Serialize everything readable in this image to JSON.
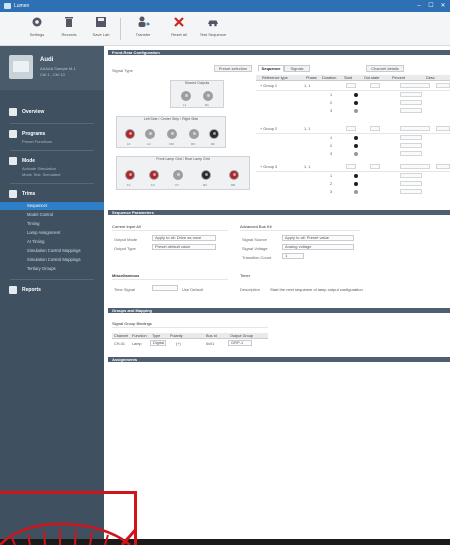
{
  "window": {
    "title": "Lumen",
    "controls": [
      "–",
      "☐",
      "✕"
    ]
  },
  "toolbar": {
    "buttons": [
      {
        "label": "Settings",
        "icon": "gear-icon"
      },
      {
        "label": "Records",
        "icon": "trash-icon"
      },
      {
        "label": "Save Lab",
        "icon": "save-icon"
      },
      {
        "label": "Transfer",
        "icon": "user-transfer-icon"
      },
      {
        "label": "Reset all",
        "icon": "close-icon"
      },
      {
        "label": "Test Sequence",
        "icon": "car-icon"
      }
    ]
  },
  "sidebar": {
    "profile": {
      "name": "Audi",
      "line1": "AAAAA Sample M-1",
      "line2": "Ctrl 1 - Ctrl 10"
    },
    "sections": [
      {
        "title": "Overview",
        "icon": "list-icon",
        "sub": ""
      },
      {
        "title": "Programs",
        "icon": "program-icon",
        "sub": "Preset Functions"
      },
      {
        "title": "Mode",
        "icon": "mode-icon",
        "sub": "Activate Simulation",
        "sub2": "Mode Test: Simulated"
      },
      {
        "title": "Trims",
        "icon": "trims-icon",
        "sub": ""
      }
    ],
    "nav": [
      "Sequencer",
      "Model Control",
      "Timing",
      "Lamp Assignment",
      "AI Timing",
      "Simulation Control Mappings",
      "Simulation Control Mappings",
      "Tertiary Groups"
    ],
    "active_index": 0,
    "footer_section": {
      "title": "Reports",
      "icon": "report-icon"
    }
  },
  "main": {
    "top_section": "Front-Rear Configuration",
    "config_label": "Signal Type",
    "preset_button": "Preset selection",
    "tabs": [
      "Sequence",
      "Signals"
    ],
    "tab_right": "Channel details",
    "top_panel_label": "Shared Outputs",
    "mid_panel_label": "Left Side / Center Strip / Right Side",
    "bottom_panel_label": "Front Lamp Grid / Rear Lamp Grid",
    "dot_labels_top": [
      "L1",
      "R1"
    ],
    "dot_labels_mid": [
      "LF",
      "LC",
      "CM",
      "RC",
      "RF"
    ],
    "dot_labels_bot": [
      "FL",
      "FC",
      "CT",
      "RC",
      "RR"
    ],
    "table_headers": [
      "Reference type",
      "Phase",
      "Duration",
      "Start",
      "Out state",
      "Percent",
      "Desc"
    ],
    "table_groups": [
      {
        "label": "+ Group 1",
        "count": "1, 1",
        "rows": [
          "1",
          "2",
          "3"
        ]
      },
      {
        "label": "+ Group 2",
        "count": "1, 1",
        "rows": [
          "1",
          "2",
          "3"
        ]
      },
      {
        "label": "+ Group 3",
        "count": "1, 1",
        "rows": [
          "1",
          "2",
          "3"
        ]
      }
    ],
    "mid_section": "Sequence Parameters",
    "left_group_title": "Current Input All",
    "left_fields": [
      [
        "Output Mode",
        "Apply to all: Drive as once"
      ],
      [
        "Output Type",
        "Preset default value"
      ]
    ],
    "right_group_title": "Advanced Bus Kit",
    "right_fields": [
      [
        "Signal Source",
        "Apply to all: Preset value"
      ],
      [
        "Signal Voltage",
        "Analog voltage"
      ],
      [
        "Transition Count",
        "1"
      ]
    ],
    "misc_section": "Miscellaneous",
    "misc_left_label": "Time Signal",
    "misc_left_value": "Use Default",
    "misc_right_label": "Timer",
    "misc_right_label2": "Description",
    "misc_right_value": "Start the next sequence of lamp output configuration",
    "group_section": "Groups and Mapping",
    "group_subtitle": "Signal Group Bindings",
    "group_headers": [
      "Channel",
      "Function",
      "Type",
      "Polarity",
      "",
      "Bus Id",
      "Output Group"
    ],
    "group_row": [
      "CH-01",
      "Lamp",
      "Digital",
      "(+)",
      "",
      "0x01",
      "GRP-1"
    ],
    "last_section": "Assignments"
  },
  "colors": {
    "accent": "#2f7fc8",
    "titlebar": "#2f6fb3",
    "sidebar": "#3f5061",
    "highlight": "#d0141a"
  }
}
